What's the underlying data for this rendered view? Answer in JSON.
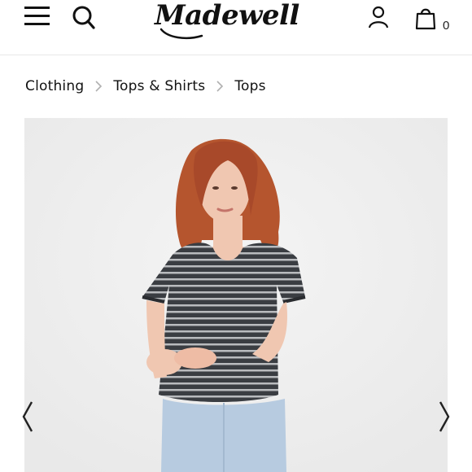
{
  "header": {
    "logo_text": "Madewell",
    "menu_icon": "hamburger-menu-icon",
    "search_icon": "search-icon",
    "account_icon": "user-account-icon",
    "bag_icon": "shopping-bag-icon",
    "bag_count": "0"
  },
  "breadcrumb": {
    "items": [
      {
        "label": "Clothing"
      },
      {
        "label": "Tops & Shirts"
      },
      {
        "label": "Tops"
      }
    ],
    "separator_icon": "chevron-right-icon"
  },
  "product": {
    "image_icon": "product-photo",
    "prev_icon": "chevron-left-icon",
    "next_icon": "chevron-right-icon"
  },
  "colors": {
    "image_background": "#efefef",
    "top_stripe_dark": "#3a3d42",
    "top_stripe_light": "#b9bbbe",
    "denim": "#b7cbe0",
    "hair": "#b5552e",
    "skin": "#f0c7b1"
  }
}
